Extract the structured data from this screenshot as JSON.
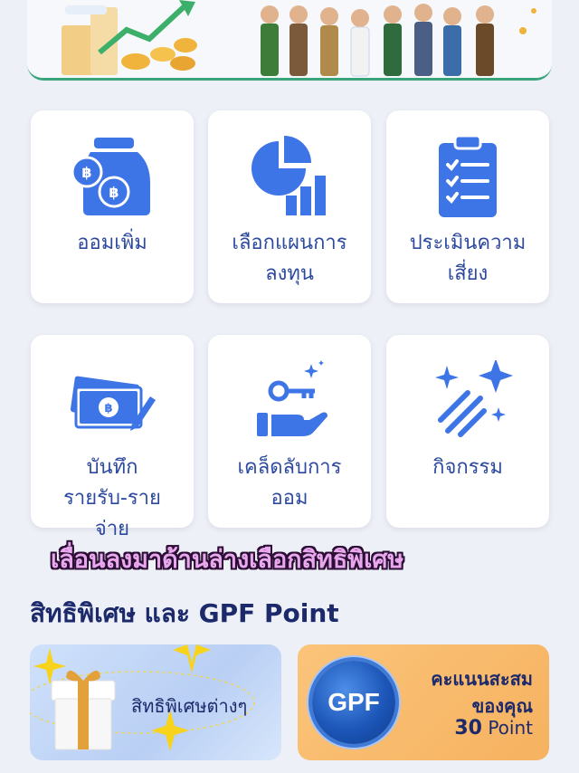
{
  "menu": {
    "tiles": [
      {
        "label": "ออมเพิ่ม",
        "icon": "savings-jar-icon"
      },
      {
        "label": "เลือกแผนการ\nลงทุน",
        "icon": "pie-bar-chart-icon"
      },
      {
        "label": "ประเมินความ\nเสี่ยง",
        "icon": "clipboard-checklist-icon"
      },
      {
        "label": "บันทึก\nรายรับ-ราย\nจ่าย",
        "icon": "money-note-pen-icon"
      },
      {
        "label": "เคล็ดลับการ\nออม",
        "icon": "key-hand-icon"
      },
      {
        "label": "กิจกรรม",
        "icon": "sparkle-stars-icon"
      }
    ]
  },
  "overlay": {
    "caption": "เลื่อนลงมาด้านล่างเลือกสิทธิพิเศษ"
  },
  "privileges": {
    "section_title": "สิทธิพิเศษ และ GPF Point",
    "privilege_card_label": "สิทธิพิเศษต่างๆ",
    "points_card": {
      "line1": "คะแนนสะสม",
      "line2": "ของคุณ",
      "points_value": "30",
      "points_unit": "Point",
      "badge_text": "GPF"
    }
  },
  "colors": {
    "accent_blue": "#3d74e6",
    "label_blue": "#2d4a9e",
    "title_navy": "#1c2a6b",
    "points_orange": "#f6b260",
    "caption_pink": "#e9a8ee"
  }
}
